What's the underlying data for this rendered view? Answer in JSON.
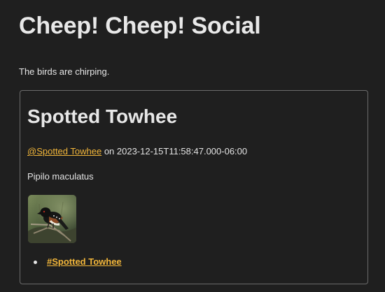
{
  "site": {
    "title": "Cheep! Cheep! Social",
    "tagline": "The birds are chirping."
  },
  "post": {
    "title": "Spotted Towhee",
    "author_handle": "@Spotted Towhee",
    "byline_connector": " on ",
    "timestamp": "2023-12-15T11:58:47.000-06:00",
    "scientific_name": "Pipilo maculatus",
    "photo_icon": "bird-photo",
    "tags": [
      {
        "label": "#Spotted Towhee"
      }
    ]
  },
  "colors": {
    "background": "#1f1f1f",
    "text": "#e7e7e7",
    "link": "#f2b63a",
    "card_border": "#6b6b6b"
  }
}
